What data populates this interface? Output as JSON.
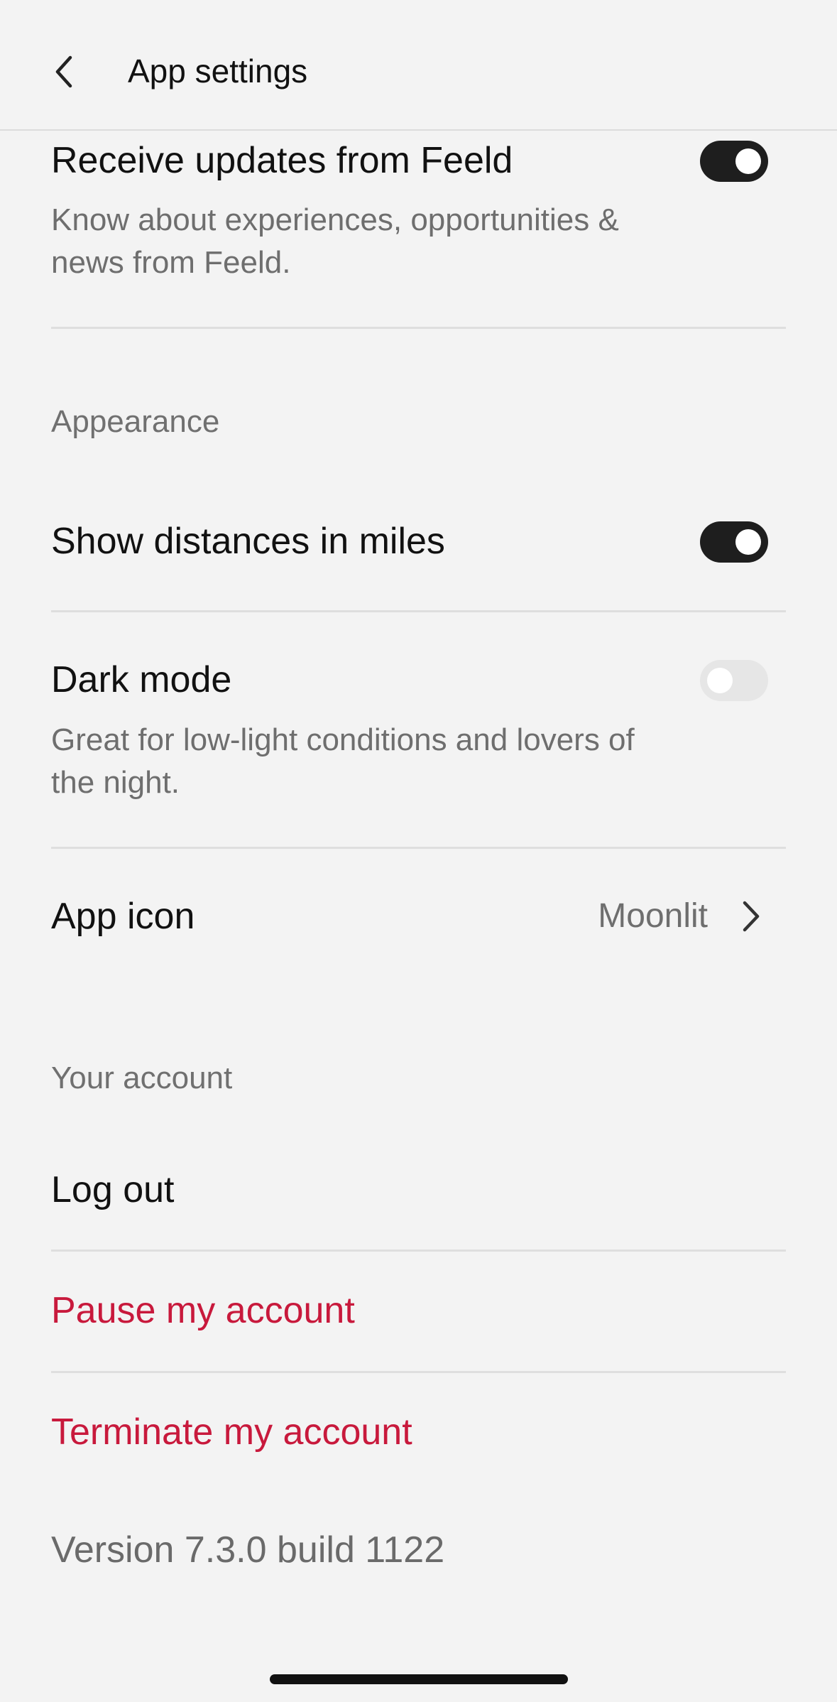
{
  "header": {
    "title": "App settings",
    "back_icon": "chevron-left-icon"
  },
  "notifications": {
    "updates_title": "Receive updates from Feeld",
    "updates_desc": "Know about experiences, opportunities & news from Feeld.",
    "updates_enabled": true
  },
  "appearance": {
    "section_label": "Appearance",
    "miles_title": "Show distances in miles",
    "miles_enabled": true,
    "dark_mode_title": "Dark mode",
    "dark_mode_desc": "Great for low-light conditions and lovers of the night.",
    "dark_mode_enabled": false,
    "app_icon_title": "App icon",
    "app_icon_value": "Moonlit"
  },
  "account": {
    "section_label": "Your account",
    "logout_label": "Log out",
    "pause_label": "Pause my account",
    "terminate_label": "Terminate my account"
  },
  "footer": {
    "version": "Version 7.3.0 build 1122"
  },
  "colors": {
    "background": "#f3f3f3",
    "danger": "#c8193c",
    "toggle_on": "#1e1e1e",
    "toggle_off": "#e6e6e6"
  }
}
